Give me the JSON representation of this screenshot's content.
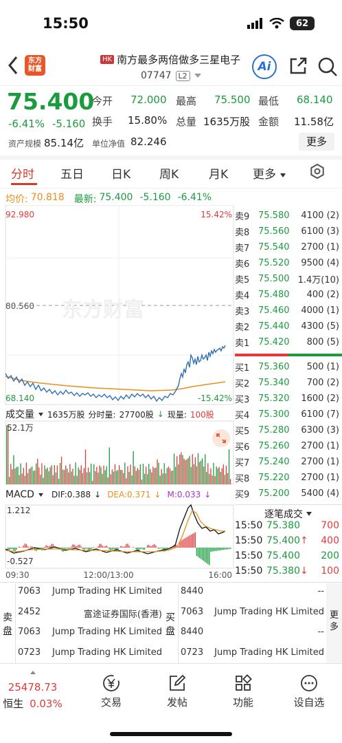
{
  "status_bar": {
    "time": "15:50",
    "battery": "62"
  },
  "header": {
    "back_icon": "chevron-left-icon",
    "logo_text": "东方\n财富",
    "market_badge": "HK",
    "title": "南方最多两倍做多三星电子",
    "code": "07747",
    "level_badge": "L2",
    "ai_label": "Ai"
  },
  "quote": {
    "price": "75.400",
    "change_pct": "-6.41%",
    "change": "-5.160",
    "open_label": "今开",
    "open": "72.000",
    "high_label": "最高",
    "high": "75.500",
    "low_label": "最低",
    "low": "68.140",
    "turnover_label": "换手",
    "turnover": "15.80%",
    "volume_label": "总量",
    "volume": "1635万股",
    "amount_label": "金额",
    "amount": "11.58亿",
    "asset_label": "资产规模",
    "asset": "85.14亿",
    "nav_label": "单位净值",
    "nav": "82.246",
    "more_label": "更多"
  },
  "tabs": [
    "分时",
    "五日",
    "日K",
    "周K",
    "月K",
    "更多"
  ],
  "intraday": {
    "avg_label": "均价:",
    "avg": "70.818",
    "last_label": "最新:",
    "last": "75.400",
    "last_change": "-5.160",
    "last_pct": "-6.41%",
    "y_top": "92.980",
    "y_top_pct": "15.42%",
    "y_mid": "80.560",
    "y_bottom": "68.140",
    "y_bottom_pct": "-15.42%",
    "watermark": "东方财富"
  },
  "volume_panel": {
    "label": "成交量",
    "total": "1635万股",
    "minute_label": "分时量:",
    "minute": "27700股",
    "current_label": "现量:",
    "current": "100股",
    "max": "52.1万"
  },
  "macd": {
    "label": "MACD",
    "dif": "DIF:0.388",
    "dea": "DEA:0.371",
    "m": "M:0.033",
    "top": "1.212",
    "bottom": "-0.527"
  },
  "time_axis": [
    "09:30",
    "12:00/13:00",
    "16:00"
  ],
  "order_book": {
    "asks": [
      {
        "label": "卖9",
        "price": "75.580",
        "vol": "4100 (2)"
      },
      {
        "label": "卖8",
        "price": "75.560",
        "vol": "6100 (3)"
      },
      {
        "label": "卖7",
        "price": "75.540",
        "vol": "2700 (1)"
      },
      {
        "label": "卖6",
        "price": "75.520",
        "vol": "9500 (4)"
      },
      {
        "label": "卖5",
        "price": "75.500",
        "vol": "1.4万(10)"
      },
      {
        "label": "卖4",
        "price": "75.480",
        "vol": "400 (2)"
      },
      {
        "label": "卖3",
        "price": "75.460",
        "vol": "4000 (1)"
      },
      {
        "label": "卖2",
        "price": "75.440",
        "vol": "4300 (5)"
      },
      {
        "label": "卖1",
        "price": "75.420",
        "vol": "800 (5)"
      }
    ],
    "bids": [
      {
        "label": "买1",
        "price": "75.360",
        "vol": "500 (1)"
      },
      {
        "label": "买2",
        "price": "75.340",
        "vol": "700 (2)"
      },
      {
        "label": "买3",
        "price": "75.320",
        "vol": "1600 (2)"
      },
      {
        "label": "买4",
        "price": "75.300",
        "vol": "6100 (7)"
      },
      {
        "label": "买5",
        "price": "75.280",
        "vol": "6300 (3)"
      },
      {
        "label": "买6",
        "price": "75.260",
        "vol": "2700 (1)"
      },
      {
        "label": "买7",
        "price": "75.240",
        "vol": "2700 (1)"
      },
      {
        "label": "买8",
        "price": "75.220",
        "vol": "2700 (1)"
      },
      {
        "label": "买9",
        "price": "75.200",
        "vol": "5400 (4)"
      }
    ]
  },
  "ticks": {
    "title": "逐笔成交",
    "rows": [
      {
        "time": "15:50",
        "price": "75.380",
        "arrow": "",
        "vol": "700",
        "color": "green",
        "vol_color": "red"
      },
      {
        "time": "15:50",
        "price": "75.400",
        "arrow": "↑",
        "vol": "400",
        "color": "green",
        "vol_color": "red"
      },
      {
        "time": "15:50",
        "price": "75.400",
        "arrow": "",
        "vol": "200",
        "color": "green",
        "vol_color": "green"
      },
      {
        "time": "15:50",
        "price": "75.380",
        "arrow": "↓",
        "vol": "100",
        "color": "green",
        "vol_color": "red"
      }
    ]
  },
  "brokers": {
    "sell_label": "卖盘",
    "buy_label": "买盘",
    "more_label": "更多",
    "sell": [
      {
        "code": "7063",
        "name": "Jump Trading HK Limited"
      },
      {
        "code": "2452",
        "name": "富途证券国际(香港)"
      },
      {
        "code": "7063",
        "name": "Jump Trading HK Limited"
      },
      {
        "code": "0723",
        "name": "Jump Trading HK Limited"
      }
    ],
    "buy": [
      {
        "code": "8440",
        "name": "--"
      },
      {
        "code": "7063",
        "name": "Jump Trading HK Limited"
      },
      {
        "code": "8440",
        "name": "--"
      },
      {
        "code": "0723",
        "name": "Jump Trading HK Limited"
      }
    ]
  },
  "bottom_nav": {
    "index_value": "25478.73",
    "index_name": "恒生",
    "index_pct": "0.03%",
    "items": [
      {
        "label": "交易",
        "icon": "yen-icon"
      },
      {
        "label": "发帖",
        "icon": "edit-icon"
      },
      {
        "label": "功能",
        "icon": "grid-icon"
      },
      {
        "label": "设自选",
        "icon": "more-icon"
      }
    ]
  },
  "colors": {
    "up": "#e23a3a",
    "down": "#1a9b3e",
    "price_line": "#2f6fb7",
    "avg_line": "#e8901a"
  }
}
